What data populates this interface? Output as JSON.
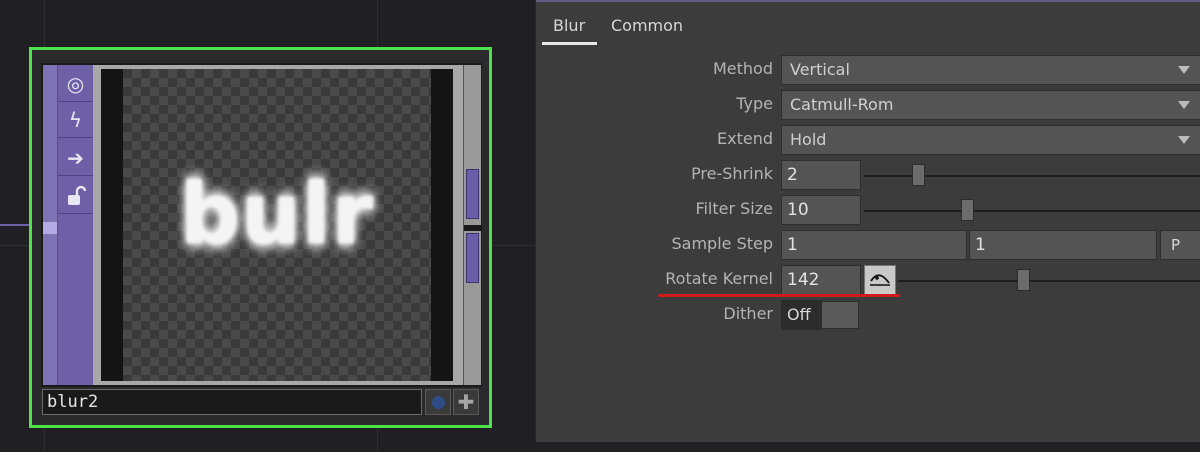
{
  "node": {
    "name": "blur2",
    "preview_text": "bulr",
    "flags": [
      {
        "icon": "viewer-target-icon",
        "glyph": "◎"
      },
      {
        "icon": "bypass-lightning-icon",
        "glyph": "ϟ"
      },
      {
        "icon": "display-arrow-icon",
        "glyph": "➔"
      },
      {
        "icon": "lock-icon",
        "glyph": "🔓"
      }
    ]
  },
  "panel": {
    "tabs": [
      {
        "label": "Blur",
        "active": true
      },
      {
        "label": "Common",
        "active": false
      }
    ],
    "params": {
      "method": {
        "label": "Method",
        "value": "Vertical"
      },
      "type": {
        "label": "Type",
        "value": "Catmull-Rom"
      },
      "extend": {
        "label": "Extend",
        "value": "Hold"
      },
      "pre_shrink": {
        "label": "Pre-Shrink",
        "value": "2"
      },
      "filter_size": {
        "label": "Filter Size",
        "value": "10"
      },
      "sample_step": {
        "label": "Sample Step",
        "value1": "1",
        "value2": "1",
        "button": "P"
      },
      "rotate_kernel": {
        "label": "Rotate Kernel",
        "value": "142"
      },
      "dither": {
        "label": "Dither",
        "value": "Off"
      }
    }
  },
  "colors": {
    "node_outline": "#4ee34a",
    "node_strip": "#6e5fa6",
    "panel_bg": "#3c3c3c",
    "highlight_underline": "#d21a1a"
  }
}
